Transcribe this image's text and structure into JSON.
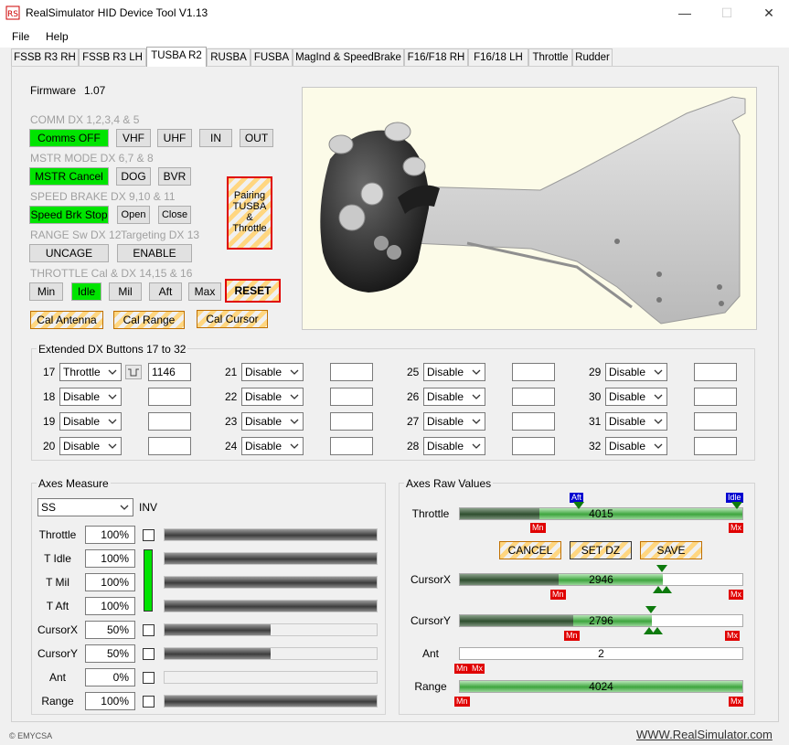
{
  "window": {
    "title": "RealSimulator HID Device Tool V1.13",
    "minimize": "—",
    "maximize": "☐",
    "close": "✕"
  },
  "menu": {
    "file": "File",
    "help": "Help"
  },
  "tabs": [
    "FSSB R3 RH",
    "FSSB R3 LH",
    "TUSBA R2",
    "RUSBA",
    "FUSBA",
    "MagInd & SpeedBrake",
    "F16/F18 RH",
    "F16/18 LH",
    "Throttle",
    "Rudder"
  ],
  "active_tab": "TUSBA R2",
  "firmware": {
    "label": "Firmware",
    "value": "1.07"
  },
  "comm": {
    "heading": "COMM DX 1,2,3,4 & 5",
    "buttons": [
      "Comms OFF",
      "VHF",
      "UHF",
      "IN",
      "OUT"
    ]
  },
  "mstr": {
    "heading": "MSTR MODE DX 6,7 & 8",
    "buttons": [
      "MSTR Cancel",
      "DOG",
      "BVR"
    ]
  },
  "speedbrake": {
    "heading": "SPEED BRAKE DX 9,10 & 11",
    "buttons": [
      "Speed Brk  Stop",
      "Open",
      "Close"
    ]
  },
  "range_sw": {
    "heading": "RANGE Sw DX 12",
    "button": "UNCAGE"
  },
  "targeting": {
    "heading": "Targeting DX 13",
    "button": "ENABLE"
  },
  "pairing": {
    "line1": "Pairing",
    "line2": "TUSBA",
    "line3": "&",
    "line4": "Throttle"
  },
  "throttle_cal": {
    "heading": "THROTTLE Cal & DX 14,15 & 16",
    "buttons": [
      "Min",
      "Idle",
      "Mil",
      "Aft",
      "Max"
    ],
    "reset": "RESET"
  },
  "cal_buttons": [
    "Cal Antenna",
    "Cal Range",
    "Cal Cursor"
  ],
  "extended": {
    "title": "Extended DX Buttons 17 to 32",
    "rows": [
      {
        "num": "17",
        "select": "Throttle",
        "text": "1146"
      },
      {
        "num": "18",
        "select": "Disable",
        "text": ""
      },
      {
        "num": "19",
        "select": "Disable",
        "text": ""
      },
      {
        "num": "20",
        "select": "Disable",
        "text": ""
      },
      {
        "num": "21",
        "select": "Disable",
        "text": ""
      },
      {
        "num": "22",
        "select": "Disable",
        "text": ""
      },
      {
        "num": "23",
        "select": "Disable",
        "text": ""
      },
      {
        "num": "24",
        "select": "Disable",
        "text": ""
      },
      {
        "num": "25",
        "select": "Disable",
        "text": ""
      },
      {
        "num": "26",
        "select": "Disable",
        "text": ""
      },
      {
        "num": "27",
        "select": "Disable",
        "text": ""
      },
      {
        "num": "28",
        "select": "Disable",
        "text": ""
      },
      {
        "num": "29",
        "select": "Disable",
        "text": ""
      },
      {
        "num": "30",
        "select": "Disable",
        "text": ""
      },
      {
        "num": "31",
        "select": "Disable",
        "text": ""
      },
      {
        "num": "32",
        "select": "Disable",
        "text": ""
      }
    ]
  },
  "axes_measure": {
    "title": "Axes Measure",
    "select": "SS",
    "inv": "INV",
    "rows": [
      {
        "label": "Throttle",
        "value": "100%",
        "fill": 1.0
      },
      {
        "label": "T Idle",
        "value": "100%",
        "fill": 1.0
      },
      {
        "label": "T Mil",
        "value": "100%",
        "fill": 1.0
      },
      {
        "label": "T Aft",
        "value": "100%",
        "fill": 1.0
      },
      {
        "label": "CursorX",
        "value": "50%",
        "fill": 0.5
      },
      {
        "label": "CursorY",
        "value": "50%",
        "fill": 0.5
      },
      {
        "label": "Ant",
        "value": "0%",
        "fill": 0.0
      },
      {
        "label": "Range",
        "value": "100%",
        "fill": 1.0
      }
    ]
  },
  "axes_raw": {
    "title": "Axes Raw Values",
    "buttons": [
      "CANCEL",
      "SET DZ",
      "SAVE"
    ],
    "rows": [
      {
        "label": "Throttle",
        "value": "4015",
        "dark": 0.28,
        "green": 1.0
      },
      {
        "label": "CursorX",
        "value": "2946",
        "dark": 0.35,
        "green": 0.72
      },
      {
        "label": "CursorY",
        "value": "2796",
        "dark": 0.4,
        "green": 0.68
      },
      {
        "label": "Ant",
        "value": "2",
        "dark": 0.0,
        "green": 0.0
      },
      {
        "label": "Range",
        "value": "4024",
        "dark": 0.0,
        "green": 1.0
      }
    ],
    "tags": {
      "aft": "Aft",
      "idle": "Idle",
      "mn": "Mn",
      "mx": "Mx"
    }
  },
  "footer": {
    "copyright": "© EMYCSA",
    "link": "WWW.RealSimulator.com"
  },
  "colors": {
    "active_green": "#00e400",
    "min_red": "#e00000",
    "marker_blue": "#0000d0",
    "marker_green": "#0e7a0e"
  }
}
